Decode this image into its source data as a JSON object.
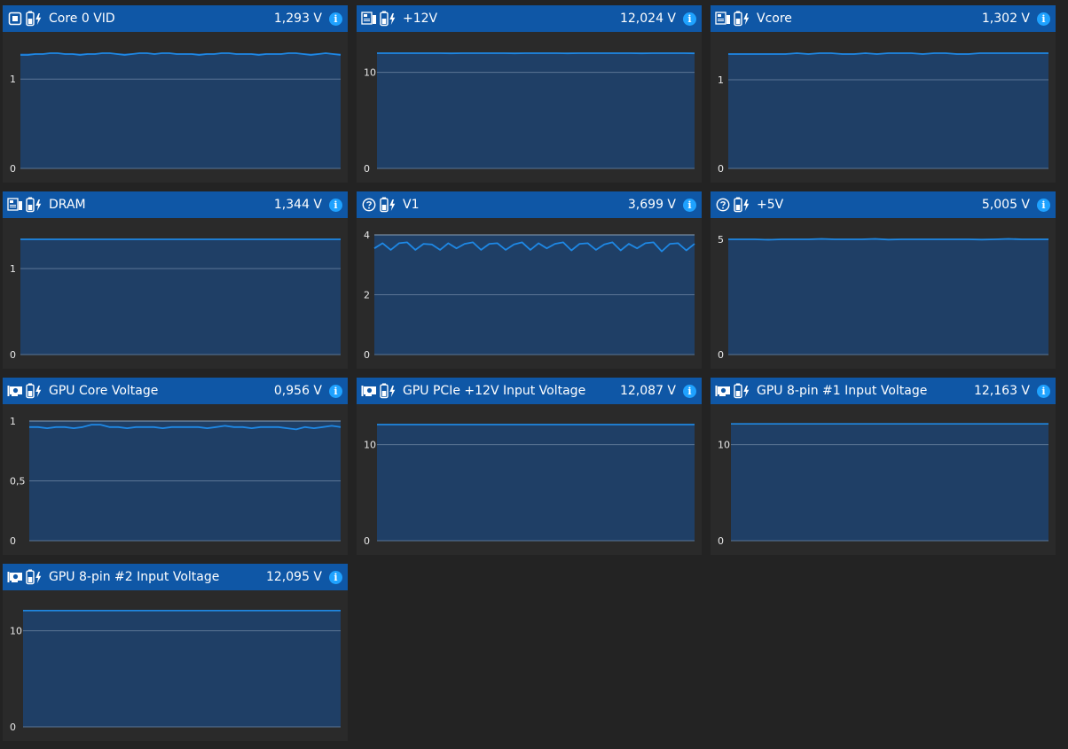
{
  "panels": [
    {
      "id": "core0vid",
      "title": "Core 0 VID",
      "value": "1,293 V",
      "hw_icon": "cpu-icon",
      "ticks": [
        {
          "v": 0,
          "label": "0"
        },
        {
          "v": 1,
          "label": "1"
        }
      ],
      "ymax": 1.29,
      "top_line": false,
      "series": [
        1.27,
        1.27,
        1.28,
        1.28,
        1.29,
        1.29,
        1.28,
        1.28,
        1.27,
        1.28,
        1.28,
        1.29,
        1.29,
        1.28,
        1.27,
        1.28,
        1.29,
        1.29,
        1.28,
        1.29,
        1.29,
        1.28,
        1.28,
        1.28,
        1.27,
        1.28,
        1.28,
        1.29,
        1.29,
        1.28,
        1.28,
        1.28,
        1.27,
        1.28,
        1.28,
        1.28,
        1.29,
        1.29,
        1.28,
        1.27,
        1.28,
        1.29,
        1.28,
        1.27
      ]
    },
    {
      "id": "plus12v",
      "title": "+12V",
      "value": "12,024 V",
      "hw_icon": "motherboard-icon",
      "ticks": [
        {
          "v": 0,
          "label": "0"
        },
        {
          "v": 10,
          "label": "10"
        }
      ],
      "ymax": 12.0,
      "top_line": false,
      "series": [
        12.0,
        12.0,
        12.0,
        12.0,
        12.0,
        12.0,
        12.0,
        11.98,
        12.0,
        12.0,
        12.0,
        12.0,
        12.0,
        11.98,
        12.0,
        12.0,
        12.0,
        12.0,
        11.98,
        12.0,
        12.0,
        12.0,
        12.0,
        12.0,
        12.0,
        11.98,
        12.0,
        12.0,
        12.0,
        12.0,
        11.98
      ]
    },
    {
      "id": "vcore",
      "title": "Vcore",
      "value": "1,302 V",
      "hw_icon": "motherboard-icon",
      "ticks": [
        {
          "v": 0,
          "label": "0"
        },
        {
          "v": 1,
          "label": "1"
        }
      ],
      "ymax": 1.3,
      "top_line": false,
      "series": [
        1.29,
        1.29,
        1.29,
        1.29,
        1.29,
        1.29,
        1.3,
        1.29,
        1.3,
        1.3,
        1.29,
        1.29,
        1.3,
        1.29,
        1.3,
        1.3,
        1.3,
        1.29,
        1.3,
        1.3,
        1.29,
        1.29,
        1.3,
        1.3,
        1.3,
        1.3,
        1.3,
        1.3,
        1.3
      ]
    },
    {
      "id": "dram",
      "title": "DRAM",
      "value": "1,344 V",
      "hw_icon": "motherboard-icon",
      "ticks": [
        {
          "v": 0,
          "label": "0"
        },
        {
          "v": 1,
          "label": "1"
        }
      ],
      "ymax": 1.34,
      "top_line": false,
      "series": [
        1.34,
        1.34,
        1.34,
        1.34,
        1.34,
        1.34,
        1.34,
        1.34,
        1.34,
        1.34
      ]
    },
    {
      "id": "v1",
      "title": "V1",
      "value": "3,699 V",
      "hw_icon": "question-icon",
      "ticks": [
        {
          "v": 0,
          "label": "0"
        },
        {
          "v": 2,
          "label": "2"
        },
        {
          "v": 4,
          "label": "4"
        }
      ],
      "ymax": 4.0,
      "top_line": true,
      "series": [
        3.55,
        3.72,
        3.5,
        3.72,
        3.75,
        3.5,
        3.7,
        3.68,
        3.5,
        3.72,
        3.55,
        3.7,
        3.75,
        3.5,
        3.7,
        3.72,
        3.5,
        3.68,
        3.75,
        3.5,
        3.72,
        3.55,
        3.7,
        3.75,
        3.48,
        3.7,
        3.72,
        3.5,
        3.68,
        3.75,
        3.48,
        3.7,
        3.55,
        3.72,
        3.75,
        3.45,
        3.7,
        3.72,
        3.48,
        3.7
      ]
    },
    {
      "id": "plus5v",
      "title": "+5V",
      "value": "5,005 V",
      "hw_icon": "question-icon",
      "ticks": [
        {
          "v": 0,
          "label": "0"
        },
        {
          "v": 5,
          "label": "5"
        }
      ],
      "ymax": 5.0,
      "top_line": false,
      "series": [
        5.0,
        5.0,
        5.0,
        4.98,
        5.0,
        5.0,
        5.0,
        5.02,
        5.0,
        5.0,
        5.0,
        5.02,
        4.99,
        5.0,
        5.0,
        5.0,
        5.0,
        5.0,
        5.0,
        4.99,
        5.0,
        5.02,
        5.0,
        5.0,
        5.0
      ]
    },
    {
      "id": "gpucore",
      "title": "GPU Core Voltage",
      "value": "0,956 V",
      "hw_icon": "gpu-icon",
      "ticks": [
        {
          "v": 0,
          "label": "0"
        },
        {
          "v": 0.5,
          "label": "0,5"
        },
        {
          "v": 1,
          "label": "1"
        }
      ],
      "ymax": 1.0,
      "top_line": true,
      "series": [
        0.95,
        0.95,
        0.94,
        0.95,
        0.95,
        0.94,
        0.95,
        0.97,
        0.97,
        0.95,
        0.95,
        0.94,
        0.95,
        0.95,
        0.95,
        0.94,
        0.95,
        0.95,
        0.95,
        0.95,
        0.94,
        0.95,
        0.96,
        0.95,
        0.95,
        0.94,
        0.95,
        0.95,
        0.95,
        0.94,
        0.93,
        0.95,
        0.94,
        0.95,
        0.96,
        0.95
      ]
    },
    {
      "id": "gpupcie",
      "title": "GPU PCIe +12V Input Voltage",
      "value": "12,087 V",
      "hw_icon": "gpu-icon",
      "ticks": [
        {
          "v": 0,
          "label": "0"
        },
        {
          "v": 10,
          "label": "10"
        }
      ],
      "ymax": 12.0,
      "top_line": false,
      "series": [
        12.09,
        12.09,
        12.09,
        12.09,
        12.09,
        12.09,
        12.09,
        12.09
      ]
    },
    {
      "id": "gpu8pin1",
      "title": "GPU 8-pin #1 Input Voltage",
      "value": "12,163 V",
      "hw_icon": "gpu-icon",
      "ticks": [
        {
          "v": 0,
          "label": "0"
        },
        {
          "v": 10,
          "label": "10"
        }
      ],
      "ymax": 12.0,
      "top_line": false,
      "series": [
        12.16,
        12.16,
        12.16,
        12.16,
        12.16,
        12.16,
        12.16,
        12.16
      ]
    },
    {
      "id": "gpu8pin2",
      "title": "GPU 8-pin #2 Input Voltage",
      "value": "12,095 V",
      "hw_icon": "gpu-icon",
      "ticks": [
        {
          "v": 0,
          "label": "0"
        },
        {
          "v": 10,
          "label": "10"
        }
      ],
      "ymax": 12.0,
      "top_line": false,
      "series": [
        12.1,
        12.1,
        12.1,
        12.1,
        12.1,
        12.1,
        12.1,
        12.1
      ]
    }
  ],
  "colors": {
    "header": "#0f57a6",
    "plot_fill": "#1f3f66",
    "line": "#1e88e5",
    "grid": "#5b7595",
    "panel_bg": "#2a2a2a",
    "page_bg": "#232323",
    "info": "#1fa2ff"
  },
  "icons": {
    "sensor_type": "battery-bolt-icon",
    "info": "info-icon"
  }
}
